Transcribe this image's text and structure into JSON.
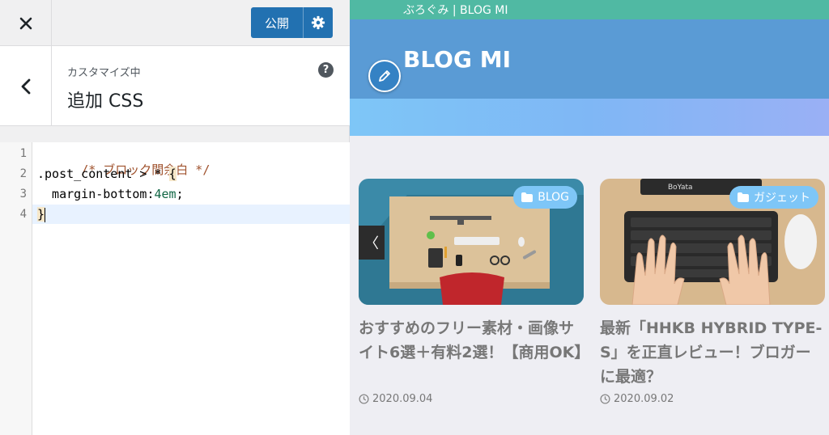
{
  "customizer": {
    "close_icon": "close-icon",
    "publish_label": "公開",
    "gear_icon": "gear-icon",
    "back_icon": "chevron-left-icon",
    "customizing_label": "カスタマイズ中",
    "section_title": "追加 CSS",
    "help_icon": "help-icon",
    "help_glyph": "?",
    "accent_color": "#2271b1"
  },
  "editor": {
    "line_numbers": [
      "1",
      "2",
      "3",
      "4"
    ],
    "lines": {
      "l1": "/* ブロック間余白 */",
      "l2a": ".post_content > * ",
      "l2b": "{",
      "l3a": "  margin-bottom:",
      "l3b": "4em",
      "l3c": ";",
      "l4": "}"
    }
  },
  "preview": {
    "topbar_text": "ぶろぐみ | BLOG MI",
    "site_title": "BLOG MI",
    "edit_icon": "pencil-icon",
    "topbar_color": "#50b9a3",
    "header_color": "#5a9bd5",
    "slider_prev_glyph": "〈",
    "cards": [
      {
        "category": "BLOG",
        "title": "おすすめのフリー素材・画像サイト6選＋有料2選！【商用OK】",
        "date": "2020.09.04"
      },
      {
        "category": "ガジェット",
        "title": "最新「HHKB HYBRID TYPE-S」を正直レビュー！ブロガーに最適？",
        "date": "2020.09.02",
        "thumb_brand": "BoYata"
      }
    ]
  }
}
